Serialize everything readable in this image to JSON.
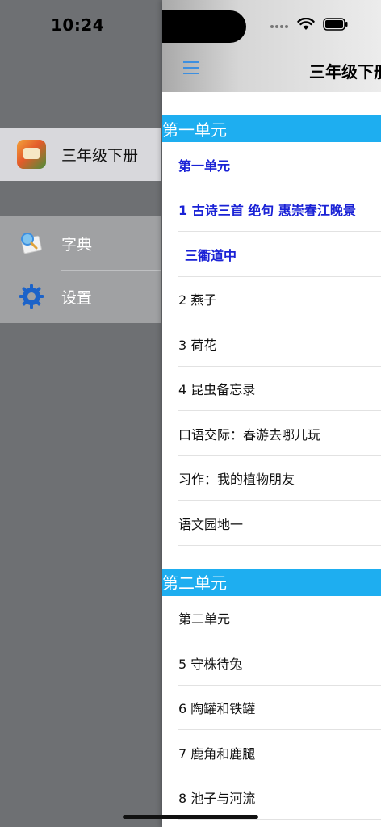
{
  "status_bar": {
    "time": "10:24"
  },
  "drawer": {
    "current_book": {
      "label": "三年级下册",
      "icon": "book-cover-icon"
    },
    "menu": [
      {
        "label": "字典",
        "icon": "dictionary-icon"
      },
      {
        "label": "设置",
        "icon": "gear-icon"
      }
    ]
  },
  "header": {
    "title": "三年级下册",
    "menu_icon": "hamburger-icon"
  },
  "sections": [
    {
      "title": "第一单元",
      "items": [
        {
          "label": "第一单元",
          "style": "blue"
        },
        {
          "label": "1 古诗三首  绝句  惠崇春江晚景",
          "style": "blue"
        },
        {
          "label": "三衢道中",
          "style": "blue-indent"
        },
        {
          "label": "2 燕子",
          "style": "plain"
        },
        {
          "label": "3 荷花",
          "style": "plain"
        },
        {
          "label": "4 昆虫备忘录",
          "style": "plain"
        },
        {
          "label": "口语交际：春游去哪儿玩",
          "style": "plain"
        },
        {
          "label": "习作：我的植物朋友",
          "style": "plain"
        },
        {
          "label": "语文园地一",
          "style": "plain"
        }
      ]
    },
    {
      "title": "第二单元",
      "items": [
        {
          "label": "第二单元",
          "style": "plain"
        },
        {
          "label": "5 守株待兔",
          "style": "plain"
        },
        {
          "label": "6 陶罐和铁罐",
          "style": "plain"
        },
        {
          "label": "7 鹿角和鹿腿",
          "style": "plain"
        },
        {
          "label": "8 池子与河流",
          "style": "plain"
        }
      ]
    }
  ],
  "colors": {
    "accent": "#1eaef0",
    "link": "#1a22d6",
    "hamburger": "#3d8fe0"
  }
}
